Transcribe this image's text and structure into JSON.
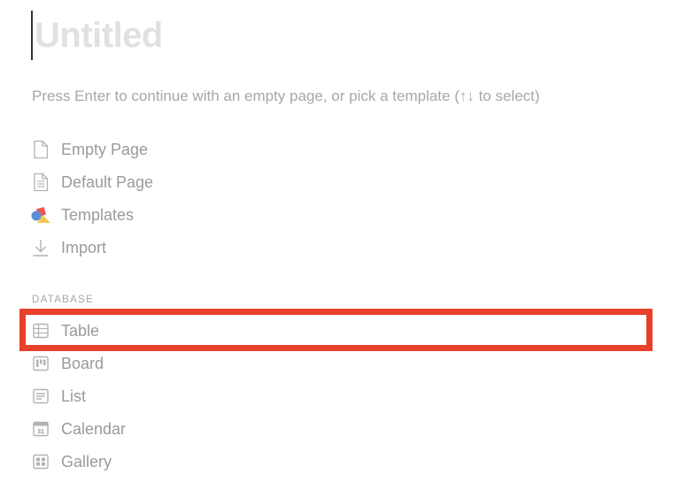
{
  "page": {
    "title_placeholder": "Untitled",
    "hint": "Press Enter to continue with an empty page, or pick a template (↑↓ to select)"
  },
  "menu": {
    "items": [
      {
        "label": "Empty Page",
        "icon": "empty-page-icon"
      },
      {
        "label": "Default Page",
        "icon": "default-page-icon"
      },
      {
        "label": "Templates",
        "icon": "templates-icon"
      },
      {
        "label": "Import",
        "icon": "import-icon"
      }
    ]
  },
  "database": {
    "section_label": "DATABASE",
    "items": [
      {
        "label": "Table",
        "icon": "table-icon"
      },
      {
        "label": "Board",
        "icon": "board-icon"
      },
      {
        "label": "List",
        "icon": "list-icon"
      },
      {
        "label": "Calendar",
        "icon": "calendar-icon"
      },
      {
        "label": "Gallery",
        "icon": "gallery-icon"
      }
    ],
    "calendar_icon_day": "31"
  },
  "annotation": {
    "highlight_color": "#e8412b",
    "highlighted_item": "Table"
  },
  "colors": {
    "title_placeholder": "#e1e1e0",
    "text_muted": "#9b9a97",
    "icon": "#b3b2af"
  }
}
